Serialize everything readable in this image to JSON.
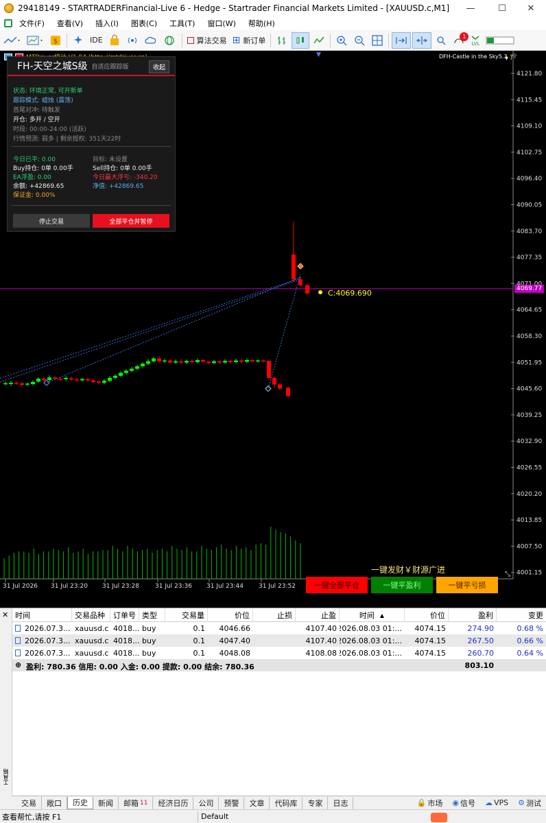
{
  "window": {
    "title": "29418149 - STARTRADERFinancial-Live 6 - Hedge - Startrader Financial Markets Limited - [XAUUSD.c,M1]"
  },
  "menu": [
    "文件(F)",
    "查看(V)",
    "插入(I)",
    "图表(C)",
    "工具(T)",
    "窗口(W)",
    "帮助(H)"
  ],
  "toolbar": {
    "ide": "IDE",
    "algo": "算法交易",
    "new_order": "新订单",
    "badge": "1",
    "lvl": "LVL"
  },
  "chart": {
    "indicator_label": "MTDriver统计 V1.94 (http://mtdriver.cn)",
    "ea_label": "DFH-Castle in the Sky5.3",
    "price_line_label": "4069.77",
    "point_label": "C:4069.690",
    "ad_text": "一键发财￥财源广进",
    "buttons": {
      "close_all": "一键全部平仓",
      "close_profit": "一键平盈利",
      "close_loss": "一键平亏损"
    },
    "colors": {
      "bull": "#00ff00",
      "bear": "#ff0000",
      "price_line": "#c000c0",
      "point": "#ffff00",
      "volume": "#00c000"
    }
  },
  "chart_data": {
    "type": "candlestick",
    "y_ticks": [
      "4121.80",
      "4115.45",
      "4109.10",
      "4102.75",
      "4096.40",
      "4090.05",
      "4083.70",
      "4077.35",
      "4071.00",
      "4064.65",
      "4058.30",
      "4051.95",
      "4045.60",
      "4039.25",
      "4032.90",
      "4026.55",
      "4020.20",
      "4013.85",
      "4007.50",
      "4001.15"
    ],
    "x_ticks": [
      "31 Jul 2026",
      "31 Jul 23:20",
      "31 Jul 23:28",
      "31 Jul 23:36",
      "31 Jul 23:44",
      "31 Jul 23:52"
    ]
  },
  "ea_panel": {
    "name": "FH-天空之城S级",
    "subtitle": "自适应跟踪版",
    "collapse": "收起",
    "status": "状态:  环境正常, 可开新单",
    "track": "跟踪模式:  蜡烛 (震荡)",
    "pair": "首尾对冲: 待触发",
    "open": "开仓:     多开 / 空开",
    "time": "时段:   00:00-24:00 (活跃)",
    "forecast": "行情预测:  弱多  |  剩余授权:  351天22时",
    "today_close": "今日已平:  0.00",
    "target": "目标:   未设置",
    "buy": "Buy持仓:    0单  0.00手",
    "sell": "Sell持仓:    0单  0.00手",
    "ea_float": "EA浮盈:   0.00",
    "max_float": "今日最大浮亏:   -340.20",
    "balance": "余额:    +42869.65",
    "equity": "净值:    +42869.65",
    "margin": "保证金:   0.00%",
    "stop": "停止交易",
    "close_all": "全部平仓并暂停"
  },
  "terminal": {
    "headers": [
      "时间",
      "交易品种",
      "订单号",
      "类型",
      "交易量",
      "价位",
      "止损",
      "止盈",
      "时间",
      "价位",
      "盈利",
      "变更"
    ],
    "rows": [
      [
        "2026.07.3...",
        "xauusd.c",
        "4018...",
        "buy",
        "0.1",
        "4046.66",
        "",
        "4107.40",
        "2026.08.03 01:...",
        "4074.15",
        "274.90",
        "0.68 %"
      ],
      [
        "2026.07.3...",
        "xauusd.c",
        "4018...",
        "buy",
        "0.1",
        "4047.40",
        "",
        "4107.40",
        "2026.08.03 01:...",
        "4074.15",
        "267.50",
        "0.66 %"
      ],
      [
        "2026.07.3...",
        "xauusd.c",
        "4018...",
        "buy",
        "0.1",
        "4048.08",
        "",
        "4108.08",
        "2026.08.03 01:...",
        "4074.15",
        "260.70",
        "0.64 %"
      ]
    ],
    "summary": "盈利: 780.36  信用: 0.00  入金: 0.00  提款: 0.00  结余: 780.36",
    "total": "803.10",
    "side_label": "工具箱",
    "tabs": [
      "交易",
      "敞口",
      "历史",
      "新闻",
      "邮箱",
      "经济日历",
      "公司",
      "预警",
      "文章",
      "代码库",
      "专家",
      "日志"
    ],
    "mail_count": "11",
    "right": [
      "市场",
      "信号",
      "VPS",
      "测试"
    ]
  },
  "status": {
    "help": "查看帮忙,请按 F1",
    "profile": "Default"
  }
}
